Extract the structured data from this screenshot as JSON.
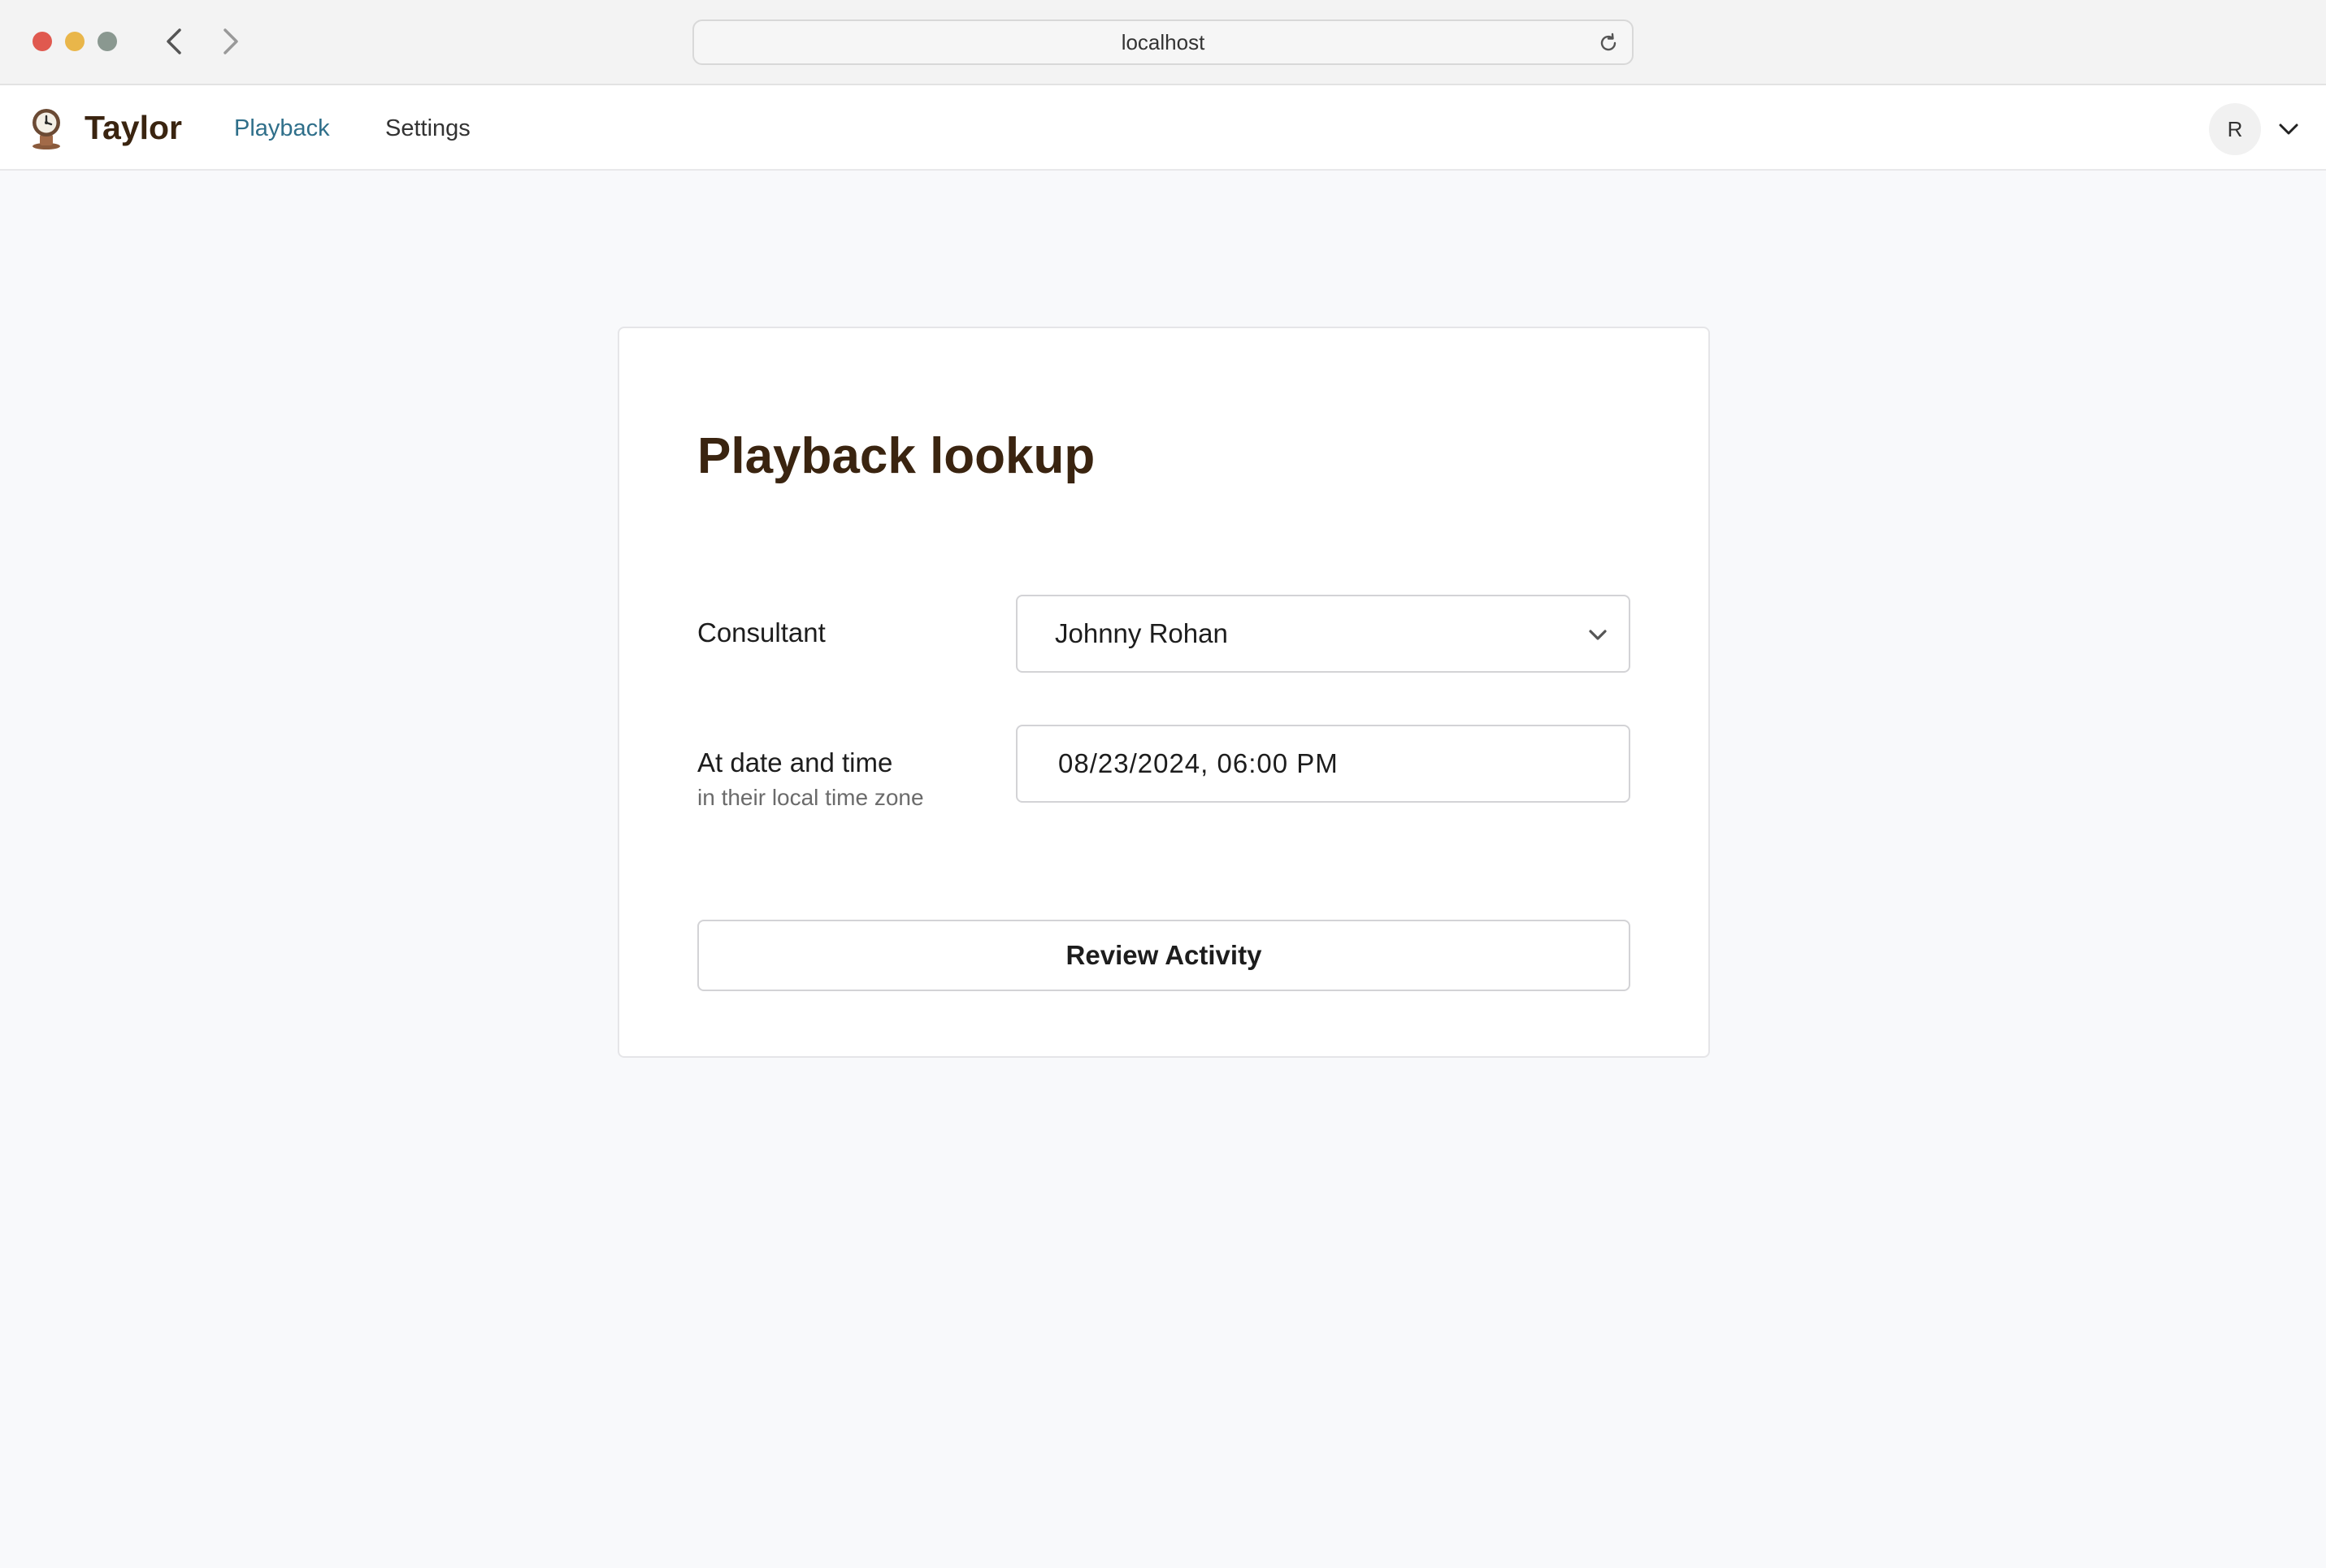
{
  "browser": {
    "url": "localhost",
    "traffic_colors": {
      "close": "#e0594f",
      "minimize": "#e9b64a",
      "maximize": "#8a9890"
    }
  },
  "header": {
    "brand": "Taylor",
    "nav": [
      {
        "label": "Playback",
        "active": true
      },
      {
        "label": "Settings",
        "active": false
      }
    ],
    "avatar_initial": "R",
    "accent_color": "#2f6f8a",
    "brand_color": "#3a2410"
  },
  "form": {
    "title": "Playback lookup",
    "consultant_label": "Consultant",
    "consultant_value": "Johnny Rohan",
    "datetime_label": "At date and time",
    "datetime_sublabel": "in their local time zone",
    "datetime_value": "08/23/2024, 06:00 PM",
    "submit_label": "Review Activity"
  },
  "icons": [
    "back-arrow-icon",
    "forward-arrow-icon",
    "reload-icon",
    "logo-icon",
    "chevron-down-icon"
  ]
}
